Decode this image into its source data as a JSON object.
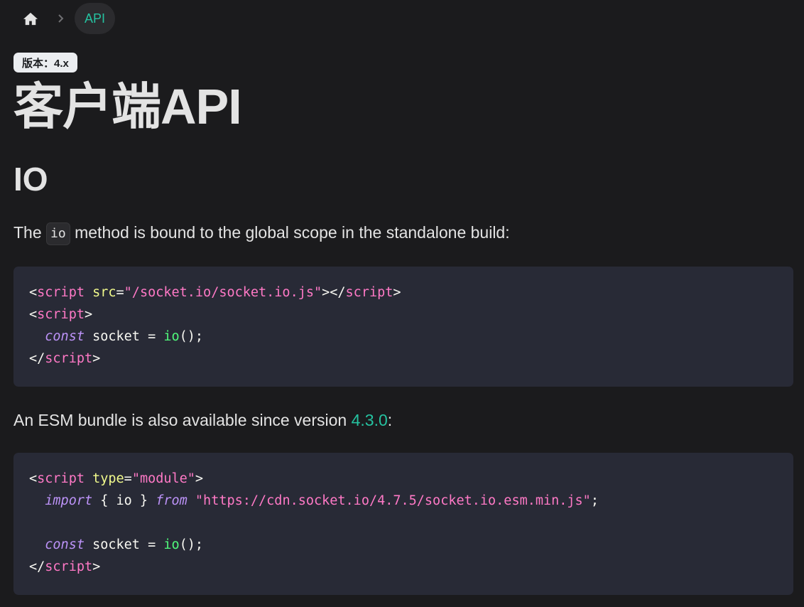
{
  "breadcrumb": {
    "home_icon": "home-icon",
    "separator_icon": "chevron-right-icon",
    "current": "API"
  },
  "badge": {
    "text": "版本：4.x"
  },
  "title": "客户端API",
  "section_heading": "IO",
  "para1": {
    "before": "The ",
    "code": "io",
    "after": " method is bound to the global scope in the standalone build:"
  },
  "code1": {
    "l1": {
      "lt": "<",
      "tag": "script",
      "attr": "src",
      "eq": "=",
      "str": "\"/socket.io/socket.io.js\"",
      "close": "></",
      "tag2": "script",
      "end": ">"
    },
    "l2": {
      "lt": "<",
      "tag": "script",
      "end": ">"
    },
    "l3": {
      "indent": "  ",
      "kw": "const",
      "mid": " socket = ",
      "fn": "io",
      "end": "();"
    },
    "l4": {
      "lt": "</",
      "tag": "script",
      "end": ">"
    }
  },
  "para2": {
    "before": "An ESM bundle is also available since version ",
    "link": "4.3.0",
    "after": ":"
  },
  "code2": {
    "l1": {
      "lt": "<",
      "tag": "script",
      "attr": "type",
      "eq": "=",
      "str": "\"module\"",
      "end": ">"
    },
    "l2": {
      "indent": "  ",
      "kw": "import",
      "mid": " { io } ",
      "kw2": "from",
      "sp": " ",
      "str": "\"https://cdn.socket.io/4.7.5/socket.io.esm.min.js\"",
      "end": ";"
    },
    "l4": {
      "indent": "  ",
      "kw": "const",
      "mid": " socket = ",
      "fn": "io",
      "end": "();"
    },
    "l5": {
      "lt": "</",
      "tag": "script",
      "end": ">"
    }
  },
  "colors": {
    "background": "#1b1b1d",
    "accent": "#25c2a0",
    "code_bg": "#282a36"
  }
}
